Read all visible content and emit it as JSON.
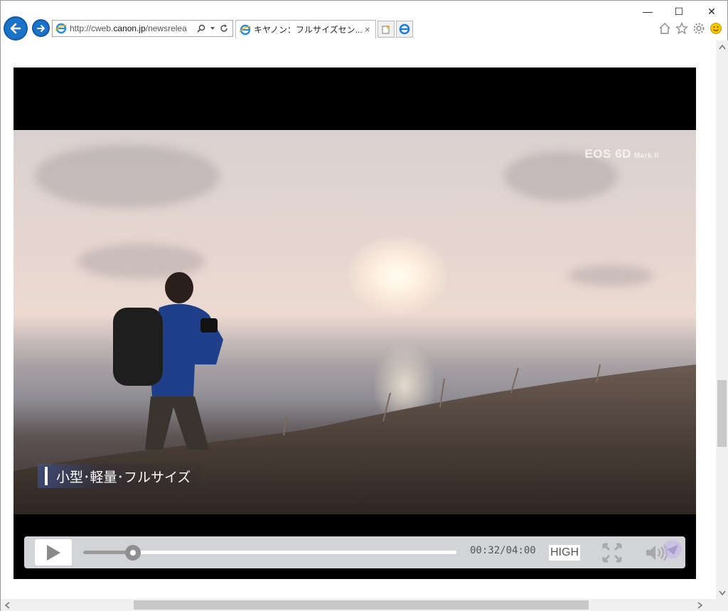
{
  "browser": {
    "address": {
      "url_prefix": "http://cweb.",
      "url_domain": "canon.jp",
      "url_suffix": "/newsrelea",
      "icon": "ie-page-icon",
      "search_icon": "search-icon",
      "dropdown_icon": "chevron-down-icon",
      "refresh_icon": "refresh-icon"
    },
    "tab": {
      "title": "キヤノン：フルサイズセン...",
      "close_label": "×",
      "icon": "ie-page-icon"
    },
    "window_controls": {
      "minimize": "—",
      "maximize": "☐",
      "close": "✕"
    },
    "toolbar_icons": [
      "home-icon",
      "favorites-star-icon",
      "settings-gear-icon",
      "smiley-feedback-icon"
    ]
  },
  "video": {
    "brand_watermark": "EOS 6D",
    "brand_watermark_suffix": "Mark II",
    "caption": "小型･軽量･フルサイズ"
  },
  "controls": {
    "time": "00:32/04:00",
    "quality": "HIGH",
    "progress_fraction": 0.133,
    "accent_colors": {
      "bar": "#d2d4d8",
      "played": "#9b9b9b",
      "track": "#ffffff"
    }
  },
  "colors": {
    "nav_button": "#1a73c9",
    "player_bg": "#000000"
  }
}
